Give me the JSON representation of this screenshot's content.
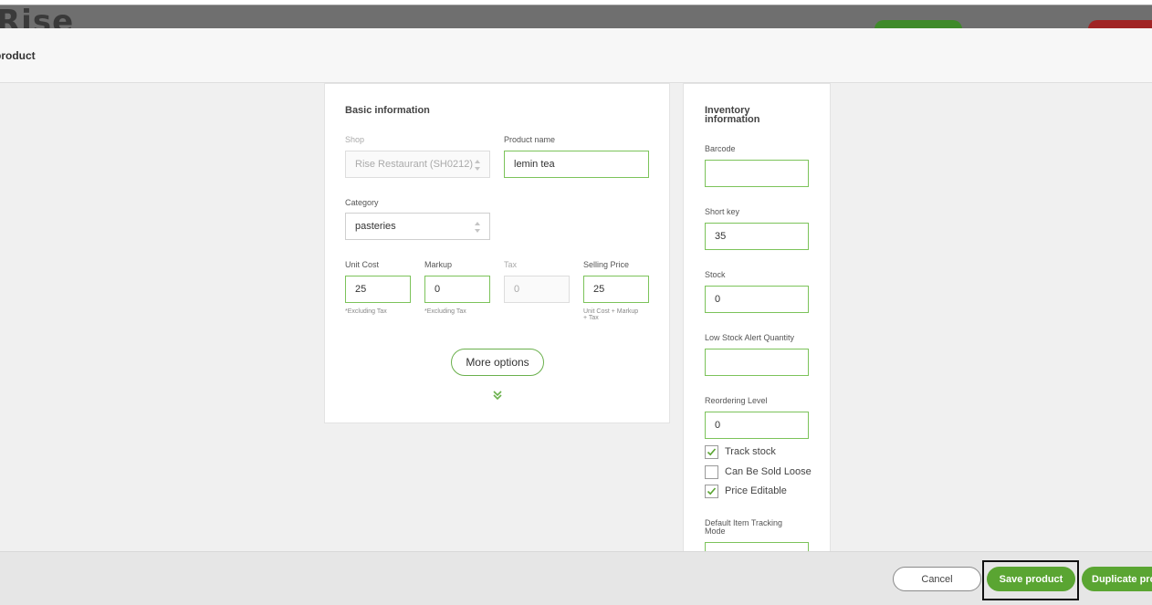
{
  "background": {
    "logo_text": "Rise"
  },
  "modal": {
    "title": "product"
  },
  "basic_info": {
    "section_title": "Basic information",
    "shop": {
      "label": "Shop",
      "value": "Rise Restaurant (SH0212)"
    },
    "product_name": {
      "label": "Product name",
      "value": "lemin tea"
    },
    "category": {
      "label": "Category",
      "value": "pasteries"
    },
    "unit_cost": {
      "label": "Unit Cost",
      "value": "25",
      "hint": "*Excluding Tax"
    },
    "markup": {
      "label": "Markup",
      "value": "0",
      "hint": "*Excluding Tax"
    },
    "tax": {
      "label": "Tax",
      "value": "0"
    },
    "selling_price": {
      "label": "Selling Price",
      "value": "25",
      "hint_line1": "Unit Cost + Markup",
      "hint_line2": "+ Tax"
    },
    "more_options_label": "More options"
  },
  "inventory": {
    "section_title_line1": "Inventory",
    "section_title_line2": "information",
    "barcode": {
      "label": "Barcode",
      "value": ""
    },
    "short_key": {
      "label": "Short key",
      "value": "35"
    },
    "stock": {
      "label": "Stock",
      "value": "0"
    },
    "low_stock": {
      "label": "Low Stock Alert Quantity",
      "value": ""
    },
    "reordering_level": {
      "label": "Reordering Level",
      "value": "0"
    },
    "checkboxes": [
      {
        "label": "Track stock",
        "checked": true
      },
      {
        "label": "Can Be Sold Loose",
        "checked": false
      },
      {
        "label": "Price Editable",
        "checked": true
      }
    ],
    "tracking_mode_line1": "Default Item Tracking",
    "tracking_mode_line2": "Mode"
  },
  "footer": {
    "cancel_label": "Cancel",
    "save_label": "Save product",
    "duplicate_label": "Duplicate pro"
  },
  "colors": {
    "accent": "#5aa532",
    "field_border": "#7cc35a",
    "check": "#5aa532"
  }
}
